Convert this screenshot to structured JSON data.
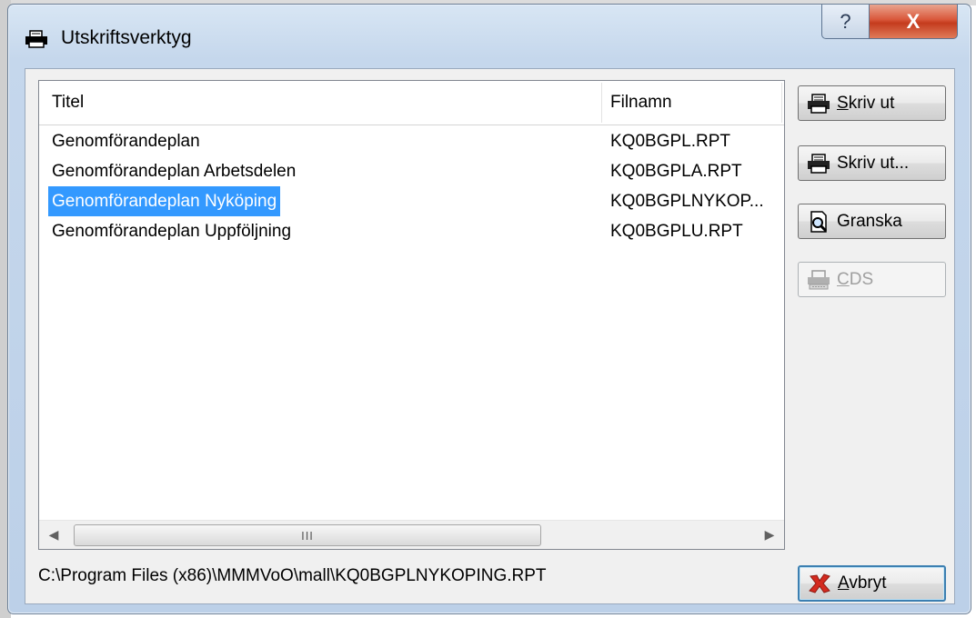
{
  "window": {
    "title": "Utskriftsverktyg",
    "help_glyph": "?",
    "close_glyph": "X"
  },
  "list": {
    "columns": [
      "Titel",
      "Filnamn"
    ],
    "rows": [
      {
        "title": "Genomförandeplan",
        "file": "KQ0BGPL.RPT",
        "selected": false
      },
      {
        "title": "Genomförandeplan Arbetsdelen",
        "file": "KQ0BGPLA.RPT",
        "selected": false
      },
      {
        "title": "Genomförandeplan Nyköping",
        "file": "KQ0BGPLNYKOP...",
        "selected": true
      },
      {
        "title": "Genomförandeplan Uppföljning",
        "file": "KQ0BGPLU.RPT",
        "selected": false
      }
    ],
    "scroll_thumb_grip": "III"
  },
  "status": {
    "path": "C:\\Program Files (x86)\\MMMVoO\\mall\\KQ0BGPLNYKOPING.RPT"
  },
  "buttons": {
    "print": {
      "mnemonic": "S",
      "rest": "kriv ut",
      "icon": "printer-icon"
    },
    "print_dialog": {
      "label": "Skriv ut...",
      "icon": "printer-icon"
    },
    "preview": {
      "label": "Granska",
      "icon": "magnifier-page-icon"
    },
    "cds": {
      "mnemonic": "C",
      "rest": "DS",
      "icon": "cds-printer-icon",
      "disabled": true
    },
    "cancel": {
      "mnemonic": "A",
      "rest": "vbryt",
      "icon": "red-x-icon"
    }
  },
  "colors": {
    "selection": "#3399ff",
    "cancel_icon": "#d42a1f",
    "close_button": "#c8462a"
  }
}
